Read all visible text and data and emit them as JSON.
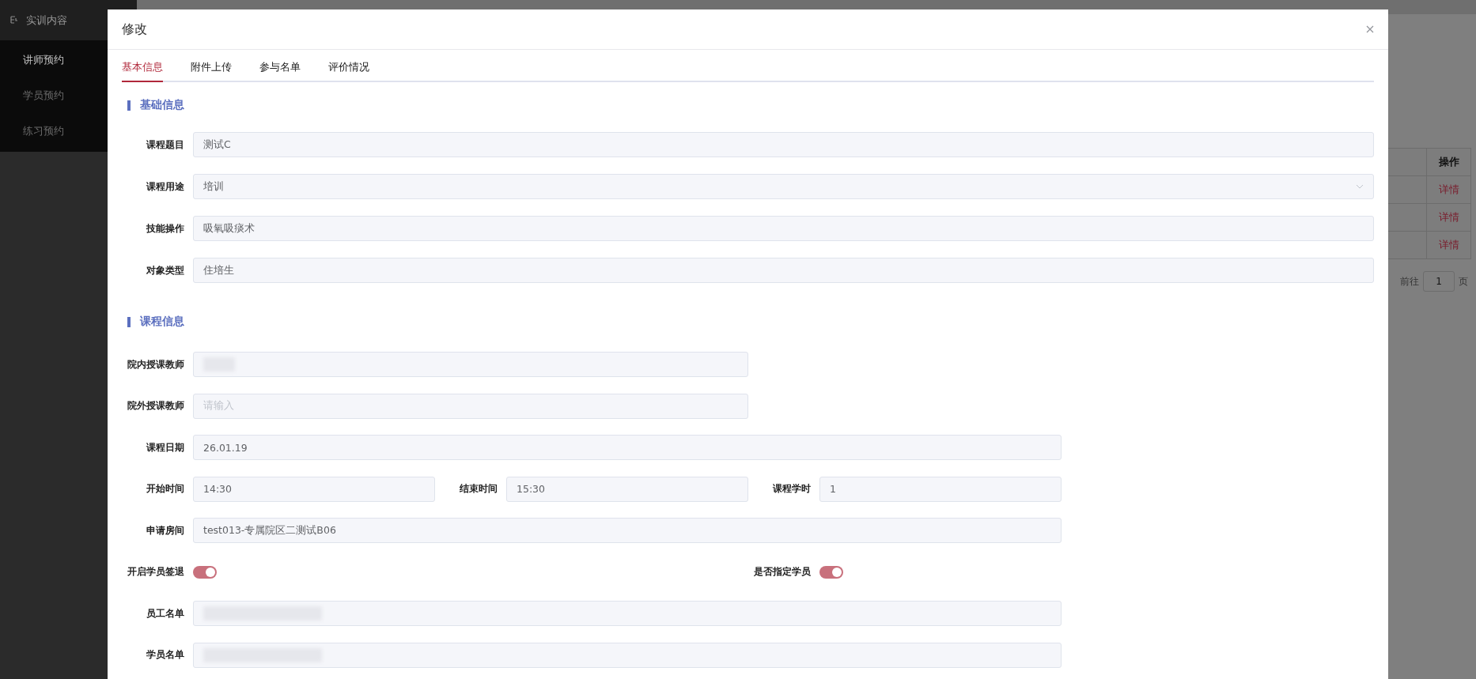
{
  "sidebar": {
    "group": {
      "label": "实训内容"
    },
    "items": [
      {
        "label": "讲师预约",
        "selected": true
      },
      {
        "label": "学员预约",
        "selected": false
      },
      {
        "label": "练习预约",
        "selected": false
      }
    ]
  },
  "background_table": {
    "columns": [
      "操作"
    ],
    "rows": [
      {
        "action": "详情"
      },
      {
        "action": "详情"
      },
      {
        "action": "详情"
      }
    ],
    "pagination": {
      "goto_label": "前往",
      "page": "1",
      "page_suffix": "页"
    }
  },
  "dialog": {
    "title": "修改",
    "tabs": [
      {
        "label": "基本信息",
        "selected": true
      },
      {
        "label": "附件上传",
        "selected": false
      },
      {
        "label": "参与名单",
        "selected": false
      },
      {
        "label": "评价情况",
        "selected": false
      }
    ],
    "sections": [
      {
        "title": "基础信息",
        "rows": [
          {
            "kind": "full",
            "fields": [
              {
                "kind": "input",
                "label": "课程题目",
                "value": "测试C"
              }
            ]
          },
          {
            "kind": "full",
            "fields": [
              {
                "kind": "select",
                "label": "课程用途",
                "value": "培训"
              }
            ]
          },
          {
            "kind": "full",
            "fields": [
              {
                "kind": "input",
                "label": "技能操作",
                "value": "吸氧吸痰术"
              }
            ]
          },
          {
            "kind": "full",
            "fields": [
              {
                "kind": "input",
                "label": "对象类型",
                "value": "住培生"
              }
            ]
          }
        ]
      },
      {
        "title": "课程信息",
        "rows": [
          {
            "kind": "half",
            "fields": [
              {
                "kind": "input",
                "label": "院内授课教师",
                "redacted": true
              }
            ]
          },
          {
            "kind": "half",
            "fields": [
              {
                "kind": "input",
                "label": "院外授课教师",
                "placeholder": "请输入"
              }
            ]
          },
          {
            "kind": "wide",
            "fields": [
              {
                "kind": "input",
                "label": "课程日期",
                "value": "26.01.19"
              }
            ]
          },
          {
            "kind": "columns",
            "fields": [
              {
                "kind": "input",
                "label": "开始时间",
                "value": "14:30"
              },
              {
                "kind": "input",
                "label": "结束时间",
                "value": "15:30"
              },
              {
                "kind": "input",
                "label": "课程学时",
                "value": "1"
              }
            ]
          },
          {
            "kind": "wide",
            "fields": [
              {
                "kind": "input",
                "label": "申请房间",
                "value": "test013-专属院区二测试B06"
              }
            ]
          },
          {
            "kind": "columns",
            "fields": [
              {
                "kind": "switch",
                "label": "开启学员签退",
                "on": true
              },
              {
                "kind": "switch",
                "label": "是否指定学员",
                "on": true
              }
            ]
          },
          {
            "kind": "wide",
            "fields": [
              {
                "kind": "input",
                "label": "员工名单",
                "redacted": true
              }
            ]
          },
          {
            "kind": "wide",
            "fields": [
              {
                "kind": "input",
                "label": "学员名单",
                "redacted": true
              }
            ]
          }
        ]
      }
    ]
  }
}
